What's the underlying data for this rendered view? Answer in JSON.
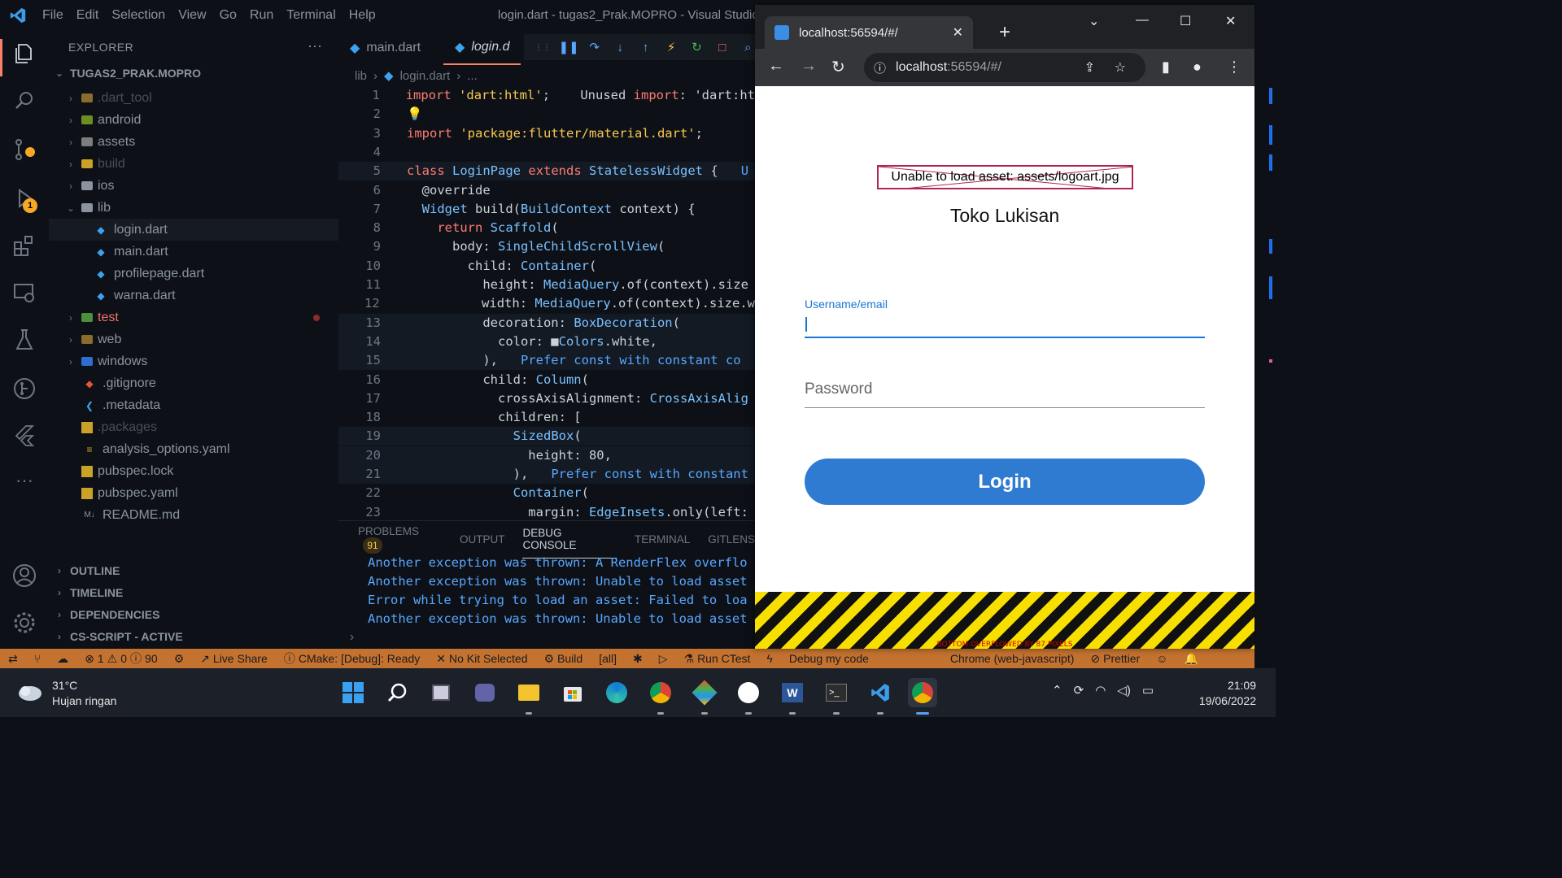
{
  "menu": [
    "File",
    "Edit",
    "Selection",
    "View",
    "Go",
    "Run",
    "Terminal",
    "Help"
  ],
  "window_title": "login.dart - tugas2_Prak.MOPRO - Visual Studio C",
  "activity_badges": {
    "run_debug": "1"
  },
  "explorer": {
    "title": "EXPLORER",
    "more": "···",
    "root": "TUGAS2_PRAK.MOPRO",
    "items": [
      {
        "label": ".dart_tool",
        "icon": "folder-icon"
      },
      {
        "label": "android",
        "icon": "android-folder-icon"
      },
      {
        "label": "assets",
        "icon": "assets-folder-icon"
      },
      {
        "label": "build",
        "icon": "folder-icon"
      },
      {
        "label": "ios",
        "icon": "ios-folder-icon"
      },
      {
        "label": "lib",
        "icon": "folder-open-icon"
      },
      {
        "label": "login.dart",
        "icon": "dart-file-icon"
      },
      {
        "label": "main.dart",
        "icon": "dart-file-icon"
      },
      {
        "label": "profilepage.dart",
        "icon": "dart-file-icon"
      },
      {
        "label": "warna.dart",
        "icon": "dart-file-icon"
      },
      {
        "label": "test",
        "icon": "test-folder-icon"
      },
      {
        "label": "web",
        "icon": "web-folder-icon"
      },
      {
        "label": "windows",
        "icon": "windows-folder-icon"
      },
      {
        "label": ".gitignore",
        "icon": "git-icon"
      },
      {
        "label": ".metadata",
        "icon": "flutter-icon"
      },
      {
        "label": ".packages",
        "icon": "file-icon"
      },
      {
        "label": "analysis_options.yaml",
        "icon": "yaml-icon"
      },
      {
        "label": "pubspec.lock",
        "icon": "lock-file-icon"
      },
      {
        "label": "pubspec.yaml",
        "icon": "yaml-icon"
      },
      {
        "label": "README.md",
        "icon": "markdown-icon"
      }
    ],
    "sections": [
      "OUTLINE",
      "TIMELINE",
      "DEPENDENCIES",
      "CS-SCRIPT - ACTIVE"
    ]
  },
  "editor": {
    "tabs": [
      "main.dart",
      "login.d"
    ],
    "breadcrumb": [
      "lib",
      "login.dart",
      "..."
    ],
    "lines": [
      {
        "n": "1",
        "text": "import 'dart:html';    Unused import: 'dart:ht"
      },
      {
        "n": "2",
        "text": "💡"
      },
      {
        "n": "3",
        "text": "import 'package:flutter/material.dart';"
      },
      {
        "n": "4",
        "text": ""
      },
      {
        "n": "5",
        "text": "class LoginPage extends StatelessWidget {   U"
      },
      {
        "n": "6",
        "text": "  @override"
      },
      {
        "n": "7",
        "text": "  Widget build(BuildContext context) {"
      },
      {
        "n": "8",
        "text": "    return Scaffold("
      },
      {
        "n": "9",
        "text": "      body: SingleChildScrollView("
      },
      {
        "n": "10",
        "text": "        child: Container("
      },
      {
        "n": "11",
        "text": "          height: MediaQuery.of(context).size"
      },
      {
        "n": "12",
        "text": "          width: MediaQuery.of(context).size.w"
      },
      {
        "n": "13",
        "text": "          decoration: BoxDecoration("
      },
      {
        "n": "14",
        "text": "            color: ■Colors.white,"
      },
      {
        "n": "15",
        "text": "          ),   Prefer const with constant co"
      },
      {
        "n": "16",
        "text": "          child: Column("
      },
      {
        "n": "17",
        "text": "            crossAxisAlignment: CrossAxisAlig"
      },
      {
        "n": "18",
        "text": "            children: ["
      },
      {
        "n": "19",
        "text": "              SizedBox("
      },
      {
        "n": "20",
        "text": "                height: 80,"
      },
      {
        "n": "21",
        "text": "              ),   Prefer const with constant"
      },
      {
        "n": "22",
        "text": "              Container("
      },
      {
        "n": "23",
        "text": "                margin: EdgeInsets.only(left:"
      }
    ]
  },
  "panel": {
    "tabs": [
      "PROBLEMS",
      "OUTPUT",
      "DEBUG CONSOLE",
      "TERMINAL",
      "GITLENS"
    ],
    "problems_count": "91",
    "console": [
      "Another exception was thrown: A RenderFlex overflo",
      "Another exception was thrown: Unable to load asset",
      "Error while trying to load an asset: Failed to loa",
      "Another exception was thrown: Unable to load asset"
    ]
  },
  "statusbar": {
    "errors": "1",
    "warnings": "0",
    "infos": "90",
    "live_share": "Live Share",
    "cmake": "CMake: [Debug]: Ready",
    "kit": "No Kit Selected",
    "build": "Build",
    "all": "[all]",
    "ctest": "Run CTest",
    "debug": "Debug my code",
    "device": "Chrome (web-javascript)",
    "prettier": "Prettier"
  },
  "browser": {
    "tab_title": "localhost:56594/#/",
    "url_host": "localhost",
    "url_rest": ":56594/#/"
  },
  "flutter": {
    "asset_error": "Unable to load asset: assets/logoart.jpg",
    "title": "Toko Lukisan",
    "username_label": "Username/email",
    "password_placeholder": "Password",
    "login_button": "Login",
    "overflow_text": "BOTTOM OVERFLOWED BY 87 PIXELS"
  },
  "taskbar": {
    "temp": "31°C",
    "weather": "Hujan ringan",
    "time": "21:09",
    "date": "19/06/2022"
  },
  "colors": {
    "statusbar": "#c47230",
    "accent": "#f78166",
    "login_button": "#2f7bd1",
    "error_border": "#b0284f"
  }
}
